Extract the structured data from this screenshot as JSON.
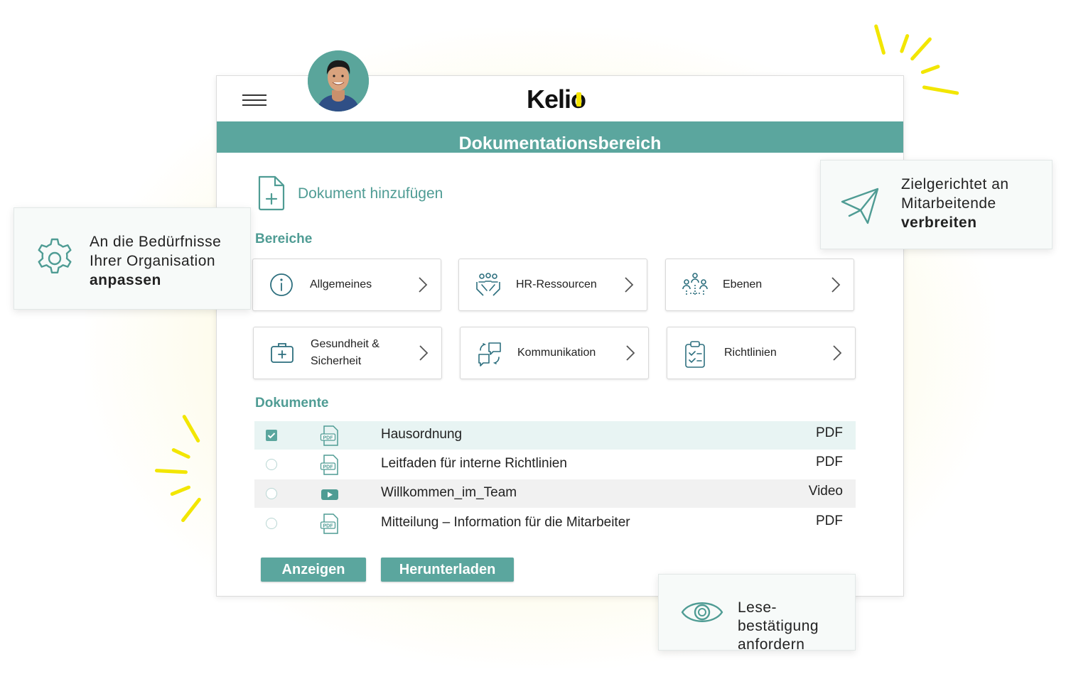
{
  "header": {
    "logo": "Kelio",
    "title": "Dokumentationsbereich"
  },
  "actions": {
    "add_document": "Dokument hinzufügen"
  },
  "sections": {
    "areas": "Bereiche",
    "documents": "Dokumente"
  },
  "areas": [
    {
      "label": "Allgemeines",
      "icon": "info-icon"
    },
    {
      "label": "HR-Ressourcen",
      "icon": "people-hands-icon"
    },
    {
      "label": "Ebenen",
      "icon": "hierarchy-icon"
    },
    {
      "label_line1": "Gesundheit &",
      "label_line2": "Sicherheit",
      "icon": "medical-kit-icon"
    },
    {
      "label": "Kommunikation",
      "icon": "chat-bubbles-icon"
    },
    {
      "label": "Richtlinien",
      "icon": "clipboard-check-icon"
    }
  ],
  "documents": [
    {
      "name": "Hausordnung",
      "type": "PDF",
      "selected": true
    },
    {
      "name": "Leitfaden für interne Richtlinien",
      "type": "PDF",
      "selected": false
    },
    {
      "name": "Willkommen_im_Team",
      "type": "Video",
      "selected": false
    },
    {
      "name": "Mitteilung – Information für die Mitarbeiter",
      "type": "PDF",
      "selected": false
    }
  ],
  "buttons": {
    "view": "Anzeigen",
    "download": "Herunterladen"
  },
  "callouts": {
    "customize": {
      "line1": "An die Bedürfnisse",
      "line2": "Ihrer Organisation",
      "bold": "anpassen"
    },
    "distribute": {
      "line1": "Zielgerichtet an",
      "line2": "Mitarbeitende",
      "bold": "verbreiten"
    },
    "read_receipt": {
      "line1": "Lese-",
      "line2": "bestätigung",
      "line3": "anfordern"
    }
  },
  "colors": {
    "accent": "#5ba69e",
    "brand_yellow": "#f2e600"
  }
}
